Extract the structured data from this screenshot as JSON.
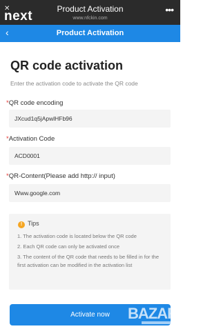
{
  "top_bar": {
    "close_glyph": "✕",
    "logo": "next",
    "title": "Product Activation",
    "url": "www.nfckin.com",
    "more_glyph": "•••"
  },
  "nav": {
    "back_glyph": "‹",
    "title": "Product Activation"
  },
  "page": {
    "heading": "QR code activation",
    "subtitle": "Enter the activation code to activate the QR code"
  },
  "fields": [
    {
      "required_mark": "*",
      "label": "QR code encoding",
      "value": "JXcud1q5jApwlHFb96"
    },
    {
      "required_mark": "*",
      "label": "Activation Code",
      "value": "ACD0001"
    },
    {
      "required_mark": "*",
      "label": "QR-Content(Please add http:// input)",
      "value": "Www.google.com"
    }
  ],
  "tips": {
    "icon_glyph": "!",
    "title": "Tips",
    "lines": [
      "1. The activation code is located below the QR code",
      "2. Each QR code can only be activated once",
      "3. The content of the QR code that needs to be filled in for the first activation can be modified in the activation list"
    ]
  },
  "button": {
    "label": "Activate now"
  },
  "watermark": {
    "text": "BAZAR"
  },
  "colors": {
    "primary": "#1e88e5",
    "required": "#e53935",
    "warning": "#f5a623",
    "top_bar": "#2b2b2b"
  }
}
